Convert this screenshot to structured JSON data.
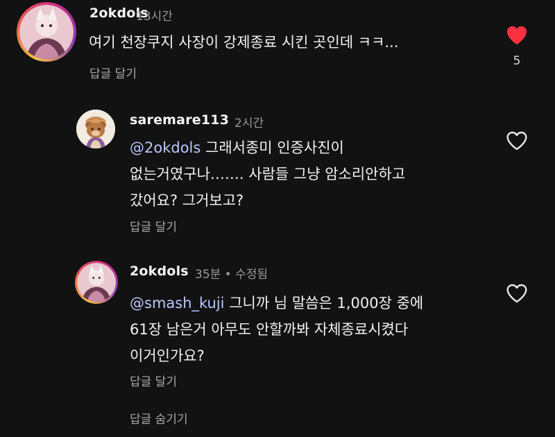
{
  "comments": [
    {
      "username": "2okdols",
      "time": "13시간",
      "text_lines": [
        "여기 천장쿠지 사장이 강제종료 시킨 곳인데 ㅋㅋ..."
      ],
      "reply_label": "답글 달기",
      "liked": true,
      "like_count": "5",
      "avatar_icon": "avatar-anime-character"
    }
  ],
  "replies": [
    {
      "username": "saremare113",
      "time": "2시간",
      "mention": "@2okdols",
      "text_lines": [
        " 그래서종미 인증사진이",
        "없는거였구나……. 사람들 그냥 암소리안하고",
        "갔어요? 그거보고?"
      ],
      "reply_label": "답글 달기",
      "liked": false,
      "avatar_icon": "avatar-bear"
    },
    {
      "username": "2okdols",
      "time": "35분 • 수정됨",
      "mention": "@smash_kuji",
      "text_lines": [
        " 그니까 님 말씀은 1,000장 중에",
        "61장 남은거 아무도 안할까봐 자체종료시켰다",
        "이거인가요?"
      ],
      "reply_label": "답글 달기",
      "liked": false,
      "avatar_icon": "avatar-anime-character"
    }
  ],
  "hide_replies_label": "답글 숨기기",
  "colors": {
    "background": "#121212",
    "liked_heart": "#ff3040",
    "mention": "#b9c7ff",
    "secondary_text": "#9a9a9a"
  }
}
